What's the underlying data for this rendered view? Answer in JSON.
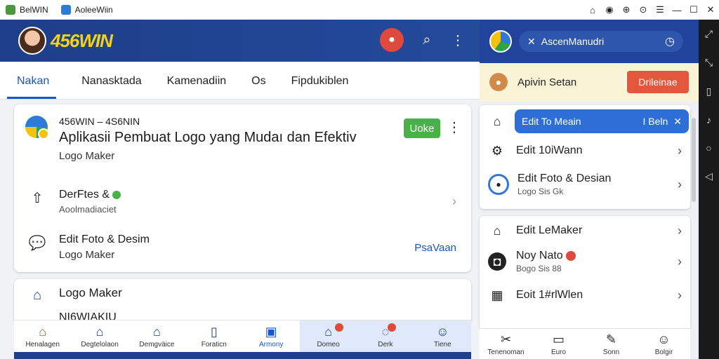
{
  "titlebar": {
    "app1": "BelWIN",
    "app2": "AoleeWiin",
    "controls": [
      "⌂",
      "◉",
      "⊕",
      "⊙",
      "☰",
      "—",
      "☐",
      "✕"
    ]
  },
  "left": {
    "brand": "456WIN",
    "tabs": [
      "Nakan",
      "Nanasktada",
      "Kamenadiin",
      "Os",
      "Fipdukiblen"
    ],
    "card1": {
      "title": "456WIN – 4S6NIN",
      "headline": "Aplikasii Pembuat Logo yang Mudaı dan Efektiv",
      "subtitle": "Logo Maker",
      "button": "Uoke",
      "row1": {
        "title": "DerFtes &",
        "sub": "Aoolmadiaciet"
      },
      "row2": {
        "title": "Edit Foto & Desim",
        "sub": "Logo Maker",
        "link": "PsaVaan"
      }
    },
    "card2": {
      "title": "Logo Maker",
      "partial": "NI6WIAKIU"
    },
    "nav": [
      {
        "label": "Henalagen",
        "icon": "house-icon"
      },
      {
        "label": "Degtelolaon",
        "icon": "house-icon"
      },
      {
        "label": "Demgväice",
        "icon": "house-icon"
      },
      {
        "label": "Foraticn",
        "icon": "phone-icon"
      },
      {
        "label": "Armony",
        "icon": "window-icon"
      },
      {
        "label": "Domeo",
        "icon": "building-icon"
      },
      {
        "label": "Derk",
        "icon": "chat-icon"
      },
      {
        "label": "Tiene",
        "icon": "person-icon"
      }
    ]
  },
  "right": {
    "search": "AscenManudri",
    "promo": {
      "text": "Apivin Setan",
      "button": "Drileinae"
    },
    "editbar": {
      "label": "Edit To Meain",
      "right": "I Beln"
    },
    "items1": [
      {
        "title": "Edit 10iWann",
        "sub": ""
      },
      {
        "title": "Edit Foto & Desian",
        "sub": "Logo Sis Gk"
      }
    ],
    "items2": [
      {
        "title": "Edit LeMaker",
        "sub": ""
      },
      {
        "title": "Noy Nato",
        "sub": "Bogo Sis 88"
      },
      {
        "title": "Eoit 1#rlWlen",
        "sub": ""
      }
    ],
    "nav": [
      {
        "label": "Tenenoman"
      },
      {
        "label": "Euro"
      },
      {
        "label": "Sonn"
      },
      {
        "label": "Bolgir"
      }
    ]
  }
}
